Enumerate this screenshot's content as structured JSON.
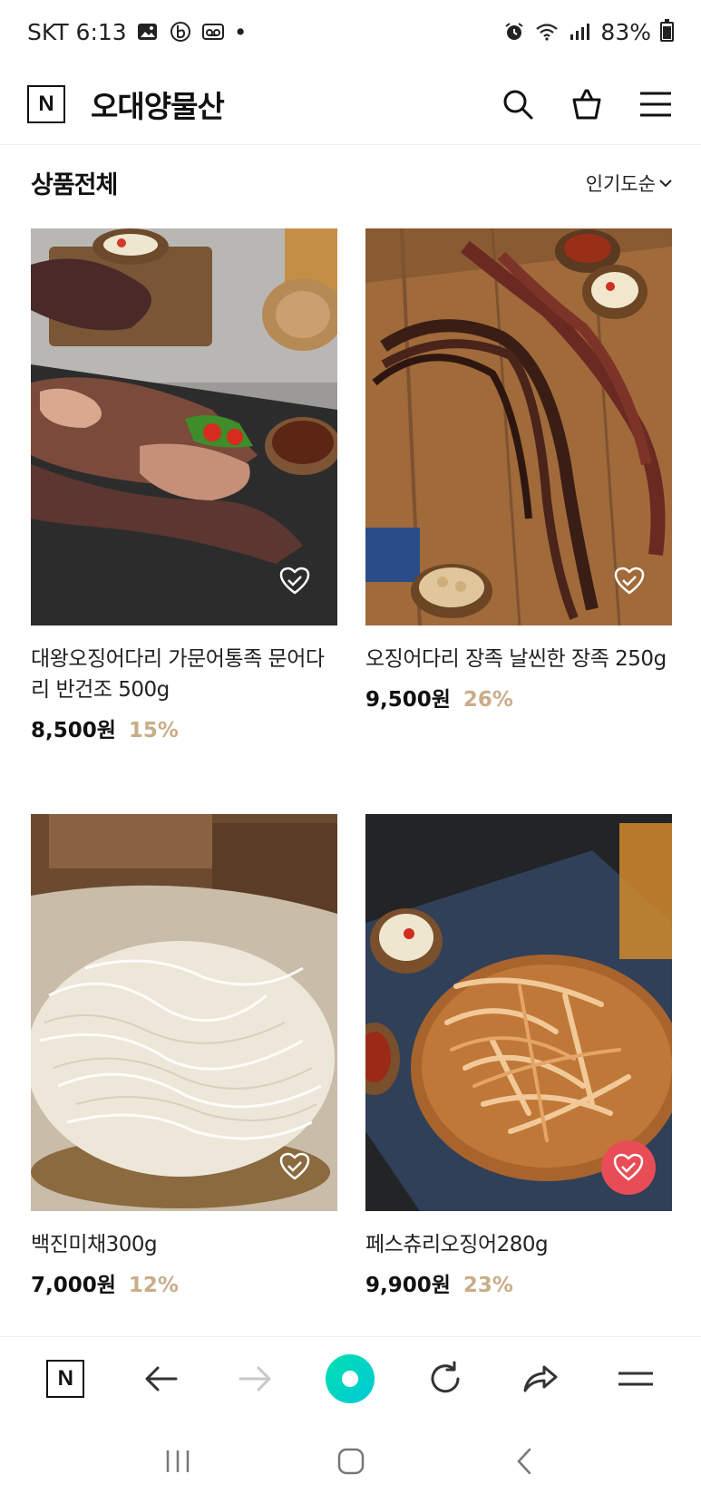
{
  "status_bar": {
    "carrier_time": "SKT 6:13",
    "dot": "•",
    "battery_text": "83%"
  },
  "header": {
    "logo_letter": "N",
    "title": "오대양물산"
  },
  "section": {
    "title": "상품전체",
    "sort_label": "인기도순"
  },
  "products": [
    {
      "name": "대왕오징어다리 가문어통족 문어다리 반건조 500g",
      "price": "8,500원",
      "discount": "15%",
      "wishlisted": false
    },
    {
      "name": "오징어다리 장족 날씬한 장족 250g",
      "price": "9,500원",
      "discount": "26%",
      "wishlisted": false
    },
    {
      "name": "백진미채300g",
      "price": "7,000원",
      "discount": "12%",
      "wishlisted": false
    },
    {
      "name": "페스츄리오징어280g",
      "price": "9,900원",
      "discount": "23%",
      "wishlisted": true
    }
  ],
  "browser_bar": {
    "logo_letter": "N"
  },
  "colors": {
    "discount": "#c9ad88",
    "wish_active": "#e84d57",
    "browser_accent": "#00d4c0"
  }
}
